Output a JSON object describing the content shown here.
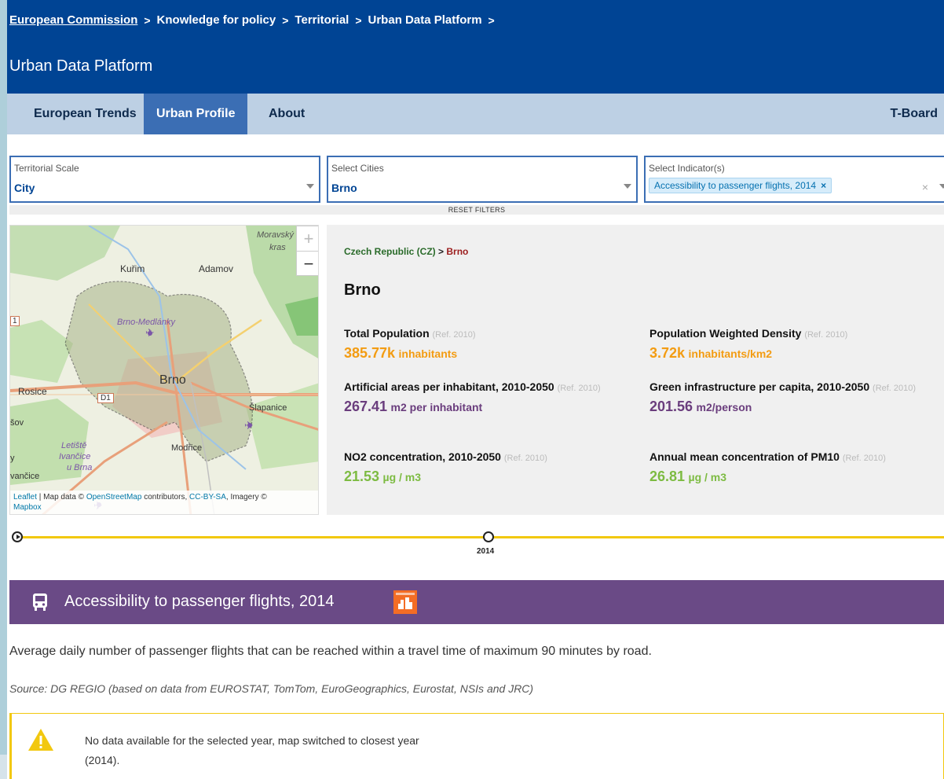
{
  "breadcrumb": {
    "items": [
      "European Commission",
      "Knowledge for policy",
      "Territorial",
      "Urban Data Platform"
    ],
    "separator": ">"
  },
  "app": {
    "title": "Urban Data Platform"
  },
  "nav": {
    "tabs": [
      {
        "label": "European Trends"
      },
      {
        "label": "Urban Profile",
        "active": true
      },
      {
        "label": "About"
      }
    ],
    "right_label": "T-Board"
  },
  "filters": {
    "scale": {
      "label": "Territorial Scale",
      "value": "City"
    },
    "cities": {
      "label": "Select Cities",
      "value": "Brno"
    },
    "indicators": {
      "label": "Select Indicator(s)",
      "chip": "Accessibility to passenger flights, 2014",
      "chip_remove": "×",
      "clear": "×"
    },
    "reset": "RESET FILTERS"
  },
  "map": {
    "zoom_in": "+",
    "zoom_out": "−",
    "labels": {
      "moravsky": "Moravský",
      "kras": "kras",
      "kurim": "Kuřim",
      "adamov": "Adamov",
      "medlanky": "Brno-Medlánky",
      "brno": "Brno",
      "rosice": "Rosice",
      "d1": "D1",
      "slapanice": "Šlapanice",
      "letiste": "Letiště",
      "ivancice_1": "Ivančice",
      "u_brna": "u Brna",
      "modrice": "Modřice",
      "vancice": "vančice",
      "sov": "šov",
      "m1": "1",
      "y": "y"
    },
    "attribution": {
      "leaflet": "Leaflet",
      "sep": " | Map data © ",
      "osm": "OpenStreetMap",
      "contrib": " contributors, ",
      "cc": "CC-BY-SA",
      "imagery": ", Imagery ©",
      "mapbox": "Mapbox"
    }
  },
  "profile": {
    "country": "Czech Republic (CZ)",
    "separator": ">",
    "city": "Brno",
    "title": "Brno",
    "indicators": [
      {
        "name": "Total Population",
        "ref": "(Ref. 2010)",
        "value": "385.77k",
        "unit": "inhabitants",
        "color": "#f39c12"
      },
      {
        "name": "Population Weighted Density",
        "ref": "(Ref. 2010)",
        "value": "3.72k",
        "unit": "inhabitants/km2",
        "color": "#f39c12"
      },
      {
        "name": "Artificial areas per inhabitant, 2010-2050",
        "ref": "(Ref. 2010)",
        "value": "267.41",
        "unit": "m2 per inhabitant",
        "color": "#6a3d7d"
      },
      {
        "name": "Green infrastructure per capita, 2010-2050",
        "ref": "(Ref. 2010)",
        "value": "201.56",
        "unit": "m2/person",
        "color": "#6a3d7d"
      },
      {
        "name": "NO2 concentration, 2010-2050",
        "ref": "(Ref. 2010)",
        "value": "21.53",
        "unit": "µg / m3",
        "color": "#7dbb42"
      },
      {
        "name": "Annual mean concentration of PM10",
        "ref": "(Ref. 2010)",
        "value": "26.81",
        "unit": "µg / m3",
        "color": "#7dbb42"
      }
    ]
  },
  "timeline": {
    "year": "2014",
    "accent": "#f2c80f"
  },
  "indicator_section": {
    "title": "Accessibility to passenger flights, 2014",
    "icon": "bus-icon",
    "sdg_icon": "sdg-11-icon",
    "background": "#6a4a86",
    "description": "Average daily number of passenger flights that can be reached within a travel time of maximum 90 minutes by road.",
    "source": "Source: DG REGIO (based on data from EUROSTAT, TomTom, EuroGeographics, Eurostat, NSIs and JRC)"
  },
  "alert": {
    "line1": "No data available for the selected year, map switched to closest year",
    "line2": "(2014)."
  }
}
